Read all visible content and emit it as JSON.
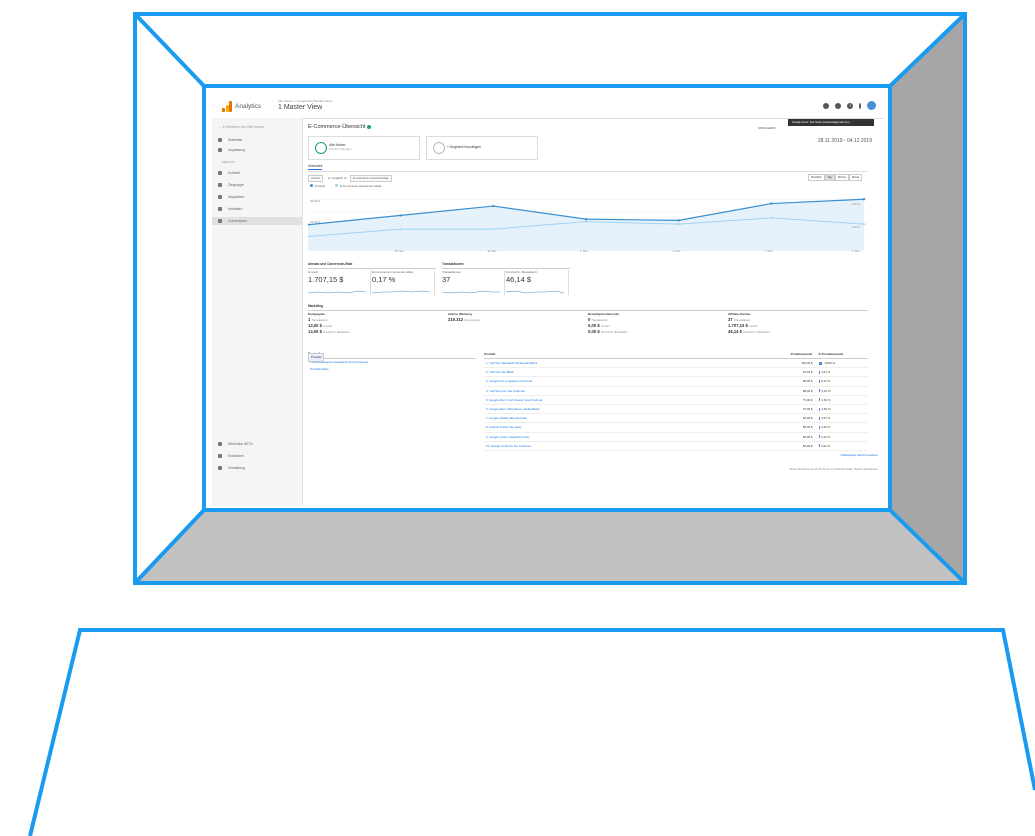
{
  "app": {
    "brand": "Analytics",
    "breadcrumb": "Alle Konten > Google Merchandise Store",
    "view": "1 Master View",
    "account_tooltip": "Google-Konto: Test Tester (testtester@gmail.com)"
  },
  "sidebar": {
    "search_placeholder": "In Berichten und Hilfe suchen",
    "items_top": [
      "Startseite",
      "Anpassung"
    ],
    "section_label": "BERICHTE",
    "items": [
      "Echtzeit",
      "Zielgruppe",
      "Akquisition",
      "Verhalten",
      "Conversions"
    ],
    "items_bottom": [
      "Attribution BETA",
      "Entdecken",
      "Verwaltung"
    ]
  },
  "page": {
    "title": "E-Commerce-Übersicht",
    "export_label": "SPEICHERN",
    "date_range": "28.11.2019 - 04.12.2019",
    "segment_all": "Alle Nutzer",
    "segment_all_sub": "100,00 % Sitzungen",
    "segment_add": "+ Segment hinzufügen",
    "tab": "Übersicht",
    "metric_select": "Umsatz",
    "compare_label": "im Vergleich zu",
    "compare_select": "E-Commerce-Conversion-Rate",
    "periods": [
      "Stündlich",
      "Tag",
      "Woche",
      "Monat"
    ],
    "active_period": "Tag"
  },
  "colors": {
    "series1": "#3a8fd0",
    "series2": "#9fd3f0",
    "accent": "#1a73e8",
    "ok": "#1ea362"
  },
  "chart_data": {
    "type": "line",
    "x": [
      "28. Nov.",
      "29. Nov.",
      "30. Nov.",
      "1. Dez.",
      "2. Dez.",
      "3. Dez.",
      "4. Dez."
    ],
    "series": [
      {
        "name": "Umsatz",
        "values": [
          195,
          270,
          345,
          240,
          230,
          365,
          400
        ]
      },
      {
        "name": "E-Commerce-Conversion-Rate",
        "values": [
          0.1,
          0.16,
          0.16,
          0.22,
          0.2,
          0.25,
          0.2
        ]
      }
    ],
    "ylabel_left_ticks": [
      "400,00 $",
      "200,00 $"
    ],
    "ylabel_right_ticks": [
      "0,40 %",
      "0,20 %"
    ]
  },
  "summary": {
    "box1_title": "Umsatz und Conversion-Rate",
    "revenue_label": "Umsatz",
    "revenue_value": "1.707,15 $",
    "cr_label": "E-Commerce-Conversion-Rate",
    "cr_value": "0,17 %",
    "box2_title": "Transaktionen",
    "tx_label": "Transaktionen",
    "tx_value": "37",
    "aov_label": "Durchschn. Bestellwert",
    "aov_value": "46,14 $"
  },
  "marketing": {
    "title": "Marketing",
    "cols": [
      {
        "h": "Kampagnen",
        "r1v": "1",
        "r1l": "Transaktionen",
        "r2v": "13,00 $",
        "r2l": "Umsatz",
        "r3v": "13,00 $",
        "r3l": "Durchschn. Bestellwert"
      },
      {
        "h": "Interne Werbung",
        "r1v": "219.312",
        "r1l": "Impressionen",
        "r2v": "",
        "r2l": "",
        "r3v": "",
        "r3l": ""
      },
      {
        "h": "Bestellgutscheincode",
        "r1v": "0",
        "r1l": "Transaktionen",
        "r2v": "0,00 $",
        "r2l": "Umsatz",
        "r3v": "0,00 $",
        "r3l": "Durchschn. Bestellwert"
      },
      {
        "h": "Affiliate-Partner",
        "r1v": "37",
        "r1l": "Transaktionen",
        "r2v": "1.707,15 $",
        "r2l": "Umsatz",
        "r3v": "46,14 $",
        "r3l": "Durchschn. Bestellwert"
      }
    ]
  },
  "bestseller": {
    "title": "Bestseller",
    "rows": [
      "Produkt",
      "Produktkategorie (erweiterter E-Commerce)",
      "Produktmarke"
    ]
  },
  "products": {
    "h_name": "Produkt",
    "h_rev": "Produktumsatz",
    "h_pct": "% Produktumsatz",
    "rows": [
      {
        "name": "1. YouTube Standards Zip Hoodie Black",
        "rev": "169,00 $",
        "pct": "19,84 %",
        "frac": 0.1984
      },
      {
        "name": "2. YouTube Tee Black",
        "rev": "52,43 $",
        "pct": "3,61 %",
        "frac": 0.0361
      },
      {
        "name": "3. Google F/C Longsleeve Charcoal",
        "rev": "98,00 $",
        "pct": "3,27 %",
        "frac": 0.0327
      },
      {
        "name": "4. YouTube Icon Tee Charcoal",
        "rev": "88,00 $",
        "pct": "5,15 %",
        "frac": 0.0515
      },
      {
        "name": "5. Google Men's Tech Fleece Vest Charcoal",
        "rev": "79,00 $",
        "pct": "4,63 %",
        "frac": 0.0463
      },
      {
        "name": "6. Google Men's Microfleece Jacket Black",
        "rev": "75,00 $",
        "pct": "4,39 %",
        "frac": 0.0439
      },
      {
        "name": "7. Google Toddler Recycled Tee",
        "rev": "60,00 $",
        "pct": "3,51 %",
        "frac": 0.0351
      },
      {
        "name": "8. Android Pocket Tee Navy",
        "rev": "58,00 $",
        "pct": "3,40 %",
        "frac": 0.034
      },
      {
        "name": "9. Google Unisex Sweatshirt Gray",
        "rev": "55,00 $",
        "pct": "3,22 %",
        "frac": 0.0322
      },
      {
        "name": "10. Google Youth FC Tee Charcoal",
        "rev": "50,00 $",
        "pct": "2,93 %",
        "frac": 0.0293
      }
    ],
    "full_report": "Vollständigen Bericht ansehen"
  },
  "footer": "Dieser Bericht wurde am 05.12.19 um 10:30:33 erstellt · Bericht aktualisieren"
}
